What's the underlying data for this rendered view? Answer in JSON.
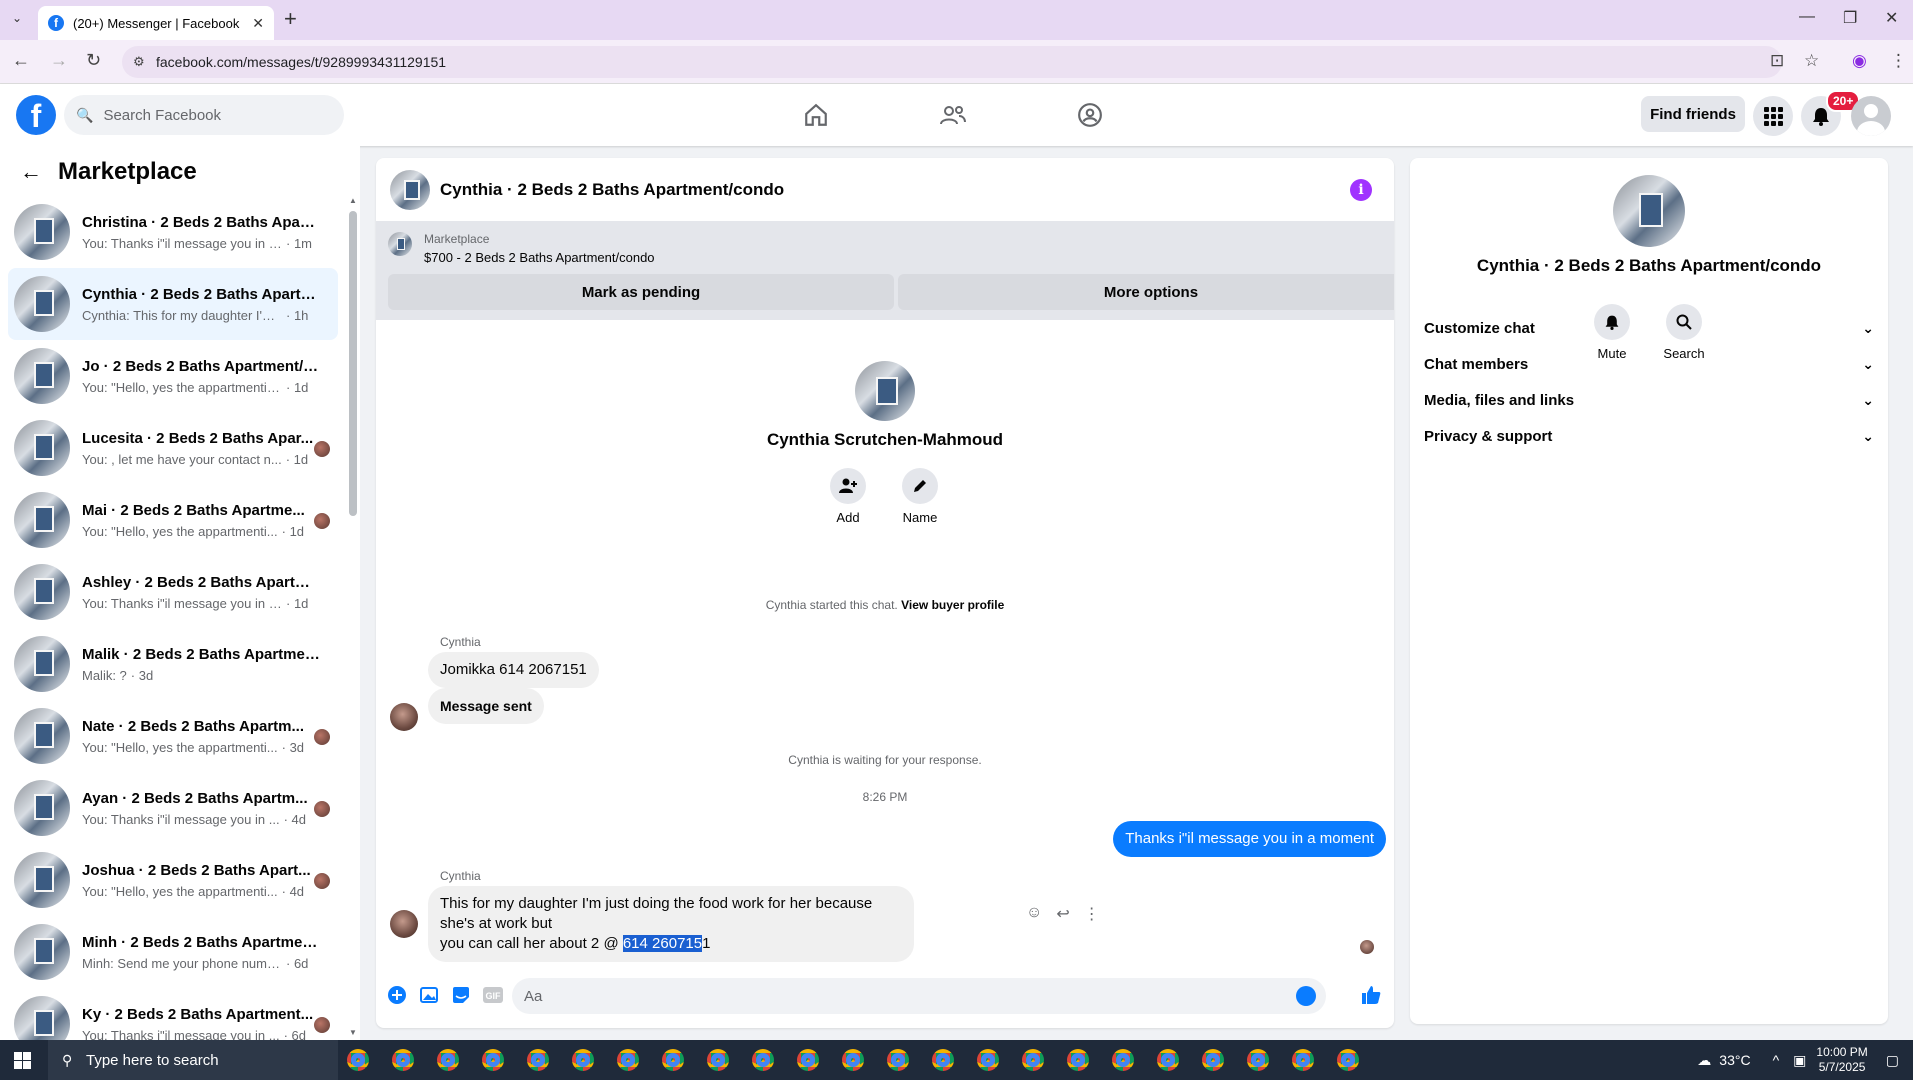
{
  "browser": {
    "tab_title": "(20+) Messenger | Facebook",
    "url": "facebook.com/messages/t/9289993431129151"
  },
  "fb": {
    "search_placeholder": "Search Facebook",
    "find_friends": "Find friends",
    "notif_badge": "20+"
  },
  "sidebar": {
    "title": "Marketplace",
    "conversations": [
      {
        "name": "Christina · 2 Beds 2 Baths Apart...",
        "preview": "You: Thanks i\"il message you in a ...",
        "time": "· 1m",
        "active": false,
        "seen": false
      },
      {
        "name": "Cynthia · 2 Beds 2 Baths Apartm...",
        "preview": "Cynthia: This for my daughter I'm j...",
        "time": "· 1h",
        "active": true,
        "seen": false
      },
      {
        "name": "Jo · 2 Beds 2 Baths Apartment/c...",
        "preview": "You: \"Hello, yes the appartmentis st...",
        "time": "· 1d",
        "active": false,
        "seen": false
      },
      {
        "name": "Lucesita · 2 Beds 2 Baths Apar...",
        "preview": "You: , let me have your contact n...",
        "time": "· 1d",
        "active": false,
        "seen": true
      },
      {
        "name": "Mai · 2 Beds 2 Baths Apartme...",
        "preview": "You: \"Hello, yes the appartmenti...",
        "time": "· 1d",
        "active": false,
        "seen": true
      },
      {
        "name": "Ashley · 2 Beds 2 Baths Apartme...",
        "preview": "You: Thanks i\"il message you in a ...",
        "time": "· 1d",
        "active": false,
        "seen": false
      },
      {
        "name": "Malik · 2 Beds 2 Baths Apartmen...",
        "preview": "Malik: ?",
        "time": "· 3d",
        "active": false,
        "seen": false
      },
      {
        "name": "Nate · 2 Beds 2 Baths Apartm...",
        "preview": "You: \"Hello, yes the appartmenti...",
        "time": "· 3d",
        "active": false,
        "seen": true
      },
      {
        "name": "Ayan · 2 Beds 2 Baths Apartm...",
        "preview": "You: Thanks i\"il message you in ...",
        "time": "· 4d",
        "active": false,
        "seen": true
      },
      {
        "name": "Joshua · 2 Beds 2 Baths Apart...",
        "preview": "You: \"Hello, yes the appartmenti...",
        "time": "· 4d",
        "active": false,
        "seen": true
      },
      {
        "name": "Minh · 2 Beds 2 Baths Apartmen...",
        "preview": "Minh: Send me your phone numbe...",
        "time": "· 6d",
        "active": false,
        "seen": false
      },
      {
        "name": "Ky · 2 Beds 2 Baths Apartment...",
        "preview": "You: Thanks i\"il message you in ...",
        "time": "· 6d",
        "active": false,
        "seen": true
      }
    ]
  },
  "chat": {
    "title": "Cynthia · 2 Beds 2 Baths Apartment/condo",
    "marketplace_label": "Marketplace",
    "listing": "$700 - 2 Beds 2 Baths Apartment/condo",
    "mark_pending": "Mark as pending",
    "more_options": "More options",
    "profile_name": "Cynthia Scrutchen-Mahmoud",
    "add_label": "Add",
    "name_label": "Name",
    "started_text": "Cynthia started this chat.",
    "view_buyer_profile": "View buyer profile",
    "sender1": "Cynthia",
    "msg1": "Jomikka 614 2067151",
    "msg2": "Message sent",
    "waiting": "Cynthia is waiting for your response.",
    "timestamp": "8:26 PM",
    "my_msg": "Thanks i\"il message you in a moment",
    "sender2": "Cynthia",
    "msg3_line1": "This for my daughter  I'm just doing the food work for her because  she's at work but",
    "msg3_line2_pre": "you can  call her about 2 @ ",
    "msg3_selected": "614 260715",
    "msg3_post": "1",
    "composer_placeholder": "Aa"
  },
  "details": {
    "title": "Cynthia · 2 Beds 2 Baths Apartment/condo",
    "mute": "Mute",
    "search": "Search",
    "sections": [
      "Customize chat",
      "Chat members",
      "Media, files and links",
      "Privacy & support"
    ]
  },
  "taskbar": {
    "search_placeholder": "Type here to search",
    "temperature": "33°C",
    "time": "10:00 PM",
    "date": "5/7/2025"
  }
}
